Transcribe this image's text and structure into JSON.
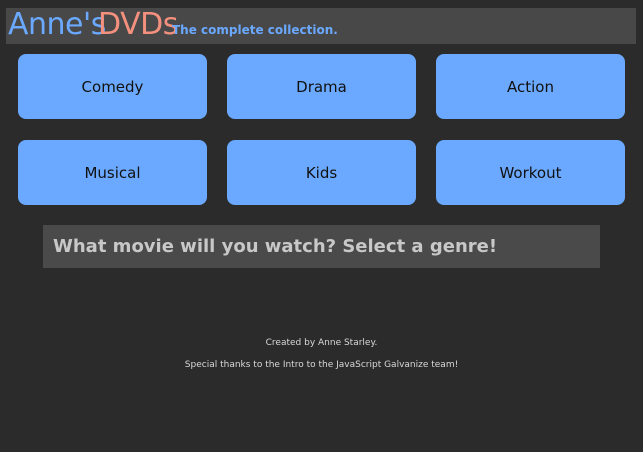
{
  "header": {
    "brand_first": "Anne's",
    "brand_second": "DVDs",
    "tagline": "The complete collection."
  },
  "genres": [
    {
      "label": "Comedy"
    },
    {
      "label": "Drama"
    },
    {
      "label": "Action"
    },
    {
      "label": "Musical"
    },
    {
      "label": "Kids"
    },
    {
      "label": "Workout"
    }
  ],
  "prompt": {
    "text": "What movie will you watch? Select a genre!"
  },
  "footer": {
    "credit": "Created by Anne Starley.",
    "thanks": "Special thanks to the Intro to the JavaScript Galvanize team!"
  },
  "colors": {
    "background": "#2b2b2b",
    "header_bg": "#484848",
    "brand_blue": "#6aa9ff",
    "brand_salmon": "#f4907e",
    "button_blue": "#6aa9ff",
    "button_text": "#111111",
    "prompt_bg": "#4a4a4a",
    "prompt_text": "#c8c8c8",
    "footer_text": "#d8d8d8"
  }
}
